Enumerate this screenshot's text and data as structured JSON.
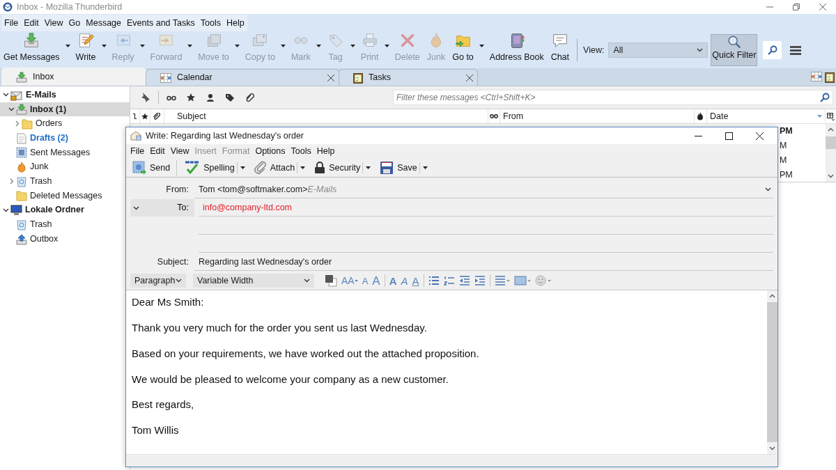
{
  "window": {
    "title": "Inbox - Mozilla Thunderbird"
  },
  "menu": [
    "File",
    "Edit",
    "View",
    "Go",
    "Message",
    "Events and Tasks",
    "Tools",
    "Help"
  ],
  "toolbar": [
    {
      "label": "Get Messages",
      "disabled": false,
      "dropdown": true
    },
    {
      "label": "Write",
      "disabled": false,
      "dropdown": true
    },
    {
      "label": "Reply",
      "disabled": true,
      "dropdown": true
    },
    {
      "label": "Forward",
      "disabled": true,
      "dropdown": true
    },
    {
      "label": "Move to",
      "disabled": true,
      "dropdown": true
    },
    {
      "label": "Copy to",
      "disabled": true,
      "dropdown": true
    },
    {
      "label": "Mark",
      "disabled": true,
      "dropdown": true
    },
    {
      "label": "Tag",
      "disabled": true,
      "dropdown": true
    },
    {
      "label": "Print",
      "disabled": true,
      "dropdown": true
    },
    {
      "label": "Delete",
      "disabled": true,
      "dropdown": false
    },
    {
      "label": "Junk",
      "disabled": true,
      "dropdown": false
    },
    {
      "label": "Go to",
      "disabled": false,
      "dropdown": true
    },
    {
      "label": "Address Book",
      "disabled": false,
      "dropdown": false
    },
    {
      "label": "Chat",
      "disabled": false,
      "dropdown": false
    }
  ],
  "view_filter": {
    "label": "View:",
    "value": "All"
  },
  "quick_filter": {
    "label": "Quick Filter",
    "pressed": true
  },
  "tabs": [
    {
      "label": "Inbox",
      "selected": true,
      "closable": false
    },
    {
      "label": "Calendar",
      "selected": false,
      "closable": true
    },
    {
      "label": "Tasks",
      "selected": false,
      "closable": true
    }
  ],
  "folders": [
    {
      "label": "E-Mails",
      "kind": "account",
      "expanded": true,
      "selected": false,
      "unread": true,
      "children": [
        {
          "label": "Inbox (1)",
          "kind": "inbox",
          "expanded": true,
          "selected": true,
          "unread": true,
          "children": [
            {
              "label": "Orders",
              "kind": "folder",
              "expanded": false,
              "selected": false,
              "unread": false
            }
          ]
        },
        {
          "label": "Drafts (2)",
          "kind": "drafts",
          "selected": false,
          "unread": true,
          "color": "#1f6fc5"
        },
        {
          "label": "Sent Messages",
          "kind": "sent",
          "selected": false,
          "unread": false
        },
        {
          "label": "Junk",
          "kind": "junk",
          "selected": false,
          "unread": false
        },
        {
          "label": "Trash",
          "kind": "trash",
          "expanded": false,
          "selected": false,
          "unread": false
        },
        {
          "label": "Deleted Messages",
          "kind": "folder",
          "selected": false,
          "unread": false
        }
      ]
    },
    {
      "label": "Lokale Ordner",
      "kind": "local",
      "expanded": true,
      "selected": false,
      "unread": true,
      "children": [
        {
          "label": "Trash",
          "kind": "trash",
          "selected": false,
          "unread": false
        },
        {
          "label": "Outbox",
          "kind": "outbox",
          "selected": false,
          "unread": false
        }
      ]
    }
  ],
  "filter_bar": {
    "placeholder": "Filter these messages <Ctrl+Shift+K>"
  },
  "columns": [
    "Subject",
    "From",
    "Date"
  ],
  "messages": [
    {
      "date": "PM",
      "unread": true
    },
    {
      "date": "M",
      "unread": false
    },
    {
      "date": "M",
      "unread": false
    },
    {
      "date": "PM",
      "unread": false
    }
  ],
  "compose": {
    "title": "Write: Regarding last Wednesday's order",
    "menu": [
      {
        "label": "File",
        "disabled": false
      },
      {
        "label": "Edit",
        "disabled": false
      },
      {
        "label": "View",
        "disabled": false
      },
      {
        "label": "Insert",
        "disabled": true
      },
      {
        "label": "Format",
        "disabled": true
      },
      {
        "label": "Options",
        "disabled": false
      },
      {
        "label": "Tools",
        "disabled": false
      },
      {
        "label": "Help",
        "disabled": false
      }
    ],
    "toolbar": [
      {
        "label": "Send",
        "dropdown": false
      },
      {
        "label": "Spelling",
        "dropdown": true
      },
      {
        "label": "Attach",
        "dropdown": true
      },
      {
        "label": "Security",
        "dropdown": true
      },
      {
        "label": "Save",
        "dropdown": true
      }
    ],
    "from": {
      "label": "From:",
      "identity": "Tom <tom@softmaker.com>",
      "account": "E-Mails"
    },
    "recipients": [
      {
        "type": "To:",
        "address": "info@company-ltd.com"
      }
    ],
    "subject": {
      "label": "Subject:",
      "value": "Regarding last Wednesday's order"
    },
    "paragraph_format": "Paragraph",
    "font": "Variable Width",
    "format_tools": [
      {
        "kind": "color"
      },
      {
        "kind": "size",
        "glyph": "AA"
      },
      {
        "kind": "smaller",
        "glyph": "A"
      },
      {
        "kind": "larger",
        "glyph": "A"
      },
      {
        "kind": "bold",
        "glyph": "A"
      },
      {
        "kind": "italic",
        "glyph": "A"
      },
      {
        "kind": "underline",
        "glyph": "A"
      },
      {
        "kind": "bullets"
      },
      {
        "kind": "numbers"
      },
      {
        "kind": "outdent"
      },
      {
        "kind": "indent"
      },
      {
        "kind": "align"
      },
      {
        "kind": "insert"
      },
      {
        "kind": "emoji"
      }
    ],
    "body": [
      "Dear Ms Smith:",
      "Thank you very much for the order you sent us last Wednesday.",
      "Based on your requirements, we have worked out the attached proposition.",
      "We would be pleased to welcome your company as a new customer.",
      "Best regards,",
      "Tom Willis"
    ]
  }
}
